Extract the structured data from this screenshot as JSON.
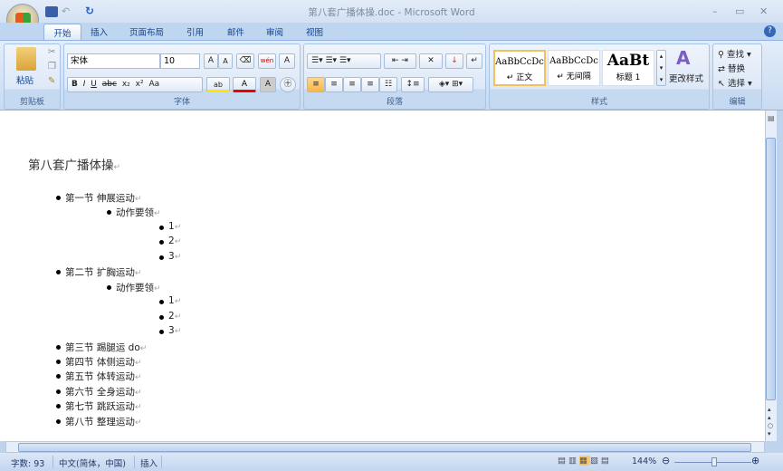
{
  "window": {
    "title": "第八套广播体操.doc - Microsoft Word",
    "minimize": "–",
    "maximize": "▭",
    "close": "✕",
    "help": "?"
  },
  "tabs": [
    "开始",
    "插入",
    "页面布局",
    "引用",
    "邮件",
    "审阅",
    "视图"
  ],
  "clipboard": {
    "paste": "粘贴",
    "label": "剪贴板"
  },
  "font": {
    "name": "宋体",
    "size": "10",
    "label": "字体",
    "buttons": [
      "B",
      "I",
      "U",
      "abc",
      "x₂",
      "x²",
      "Aa",
      "A",
      "A"
    ],
    "grow": "A",
    "shrink": "A"
  },
  "paragraph": {
    "label": "段落"
  },
  "styles": {
    "label": "样式",
    "items": [
      {
        "sample": "AaBbCcDc",
        "name": "↵ 正文"
      },
      {
        "sample": "AaBbCcDc",
        "name": "↵ 无间隔"
      },
      {
        "sample": "AaBt",
        "name": "标题 1"
      }
    ],
    "change": "更改样式"
  },
  "editing": {
    "label": "编辑",
    "find": "查找 ▾",
    "replace": "替换",
    "select": "选择 ▾"
  },
  "document": {
    "title": "第八套广播体操",
    "items": [
      {
        "level": 1,
        "text": "第一节 伸展运动"
      },
      {
        "level": 2,
        "text": "动作要领"
      },
      {
        "level": 3,
        "text": "1"
      },
      {
        "level": 3,
        "text": "2"
      },
      {
        "level": 3,
        "text": "3"
      },
      {
        "level": 1,
        "text": "第二节 扩胸运动"
      },
      {
        "level": 2,
        "text": "动作要领"
      },
      {
        "level": 3,
        "text": "1"
      },
      {
        "level": 3,
        "text": "2"
      },
      {
        "level": 3,
        "text": "3"
      },
      {
        "level": 1,
        "text": "第三节 踢腿运 do"
      },
      {
        "level": 1,
        "text": "第四节 体侧运动"
      },
      {
        "level": 1,
        "text": "第五节 体转运动"
      },
      {
        "level": 1,
        "text": "第六节 全身运动"
      },
      {
        "level": 1,
        "text": "第七节 跳跃运动"
      },
      {
        "level": 1,
        "text": "第八节 整理运动"
      }
    ],
    "para_mark": "↵"
  },
  "status": {
    "words": "字数: 93",
    "language": "中文(简体，中国)",
    "mode": "插入",
    "zoom": "144%"
  }
}
